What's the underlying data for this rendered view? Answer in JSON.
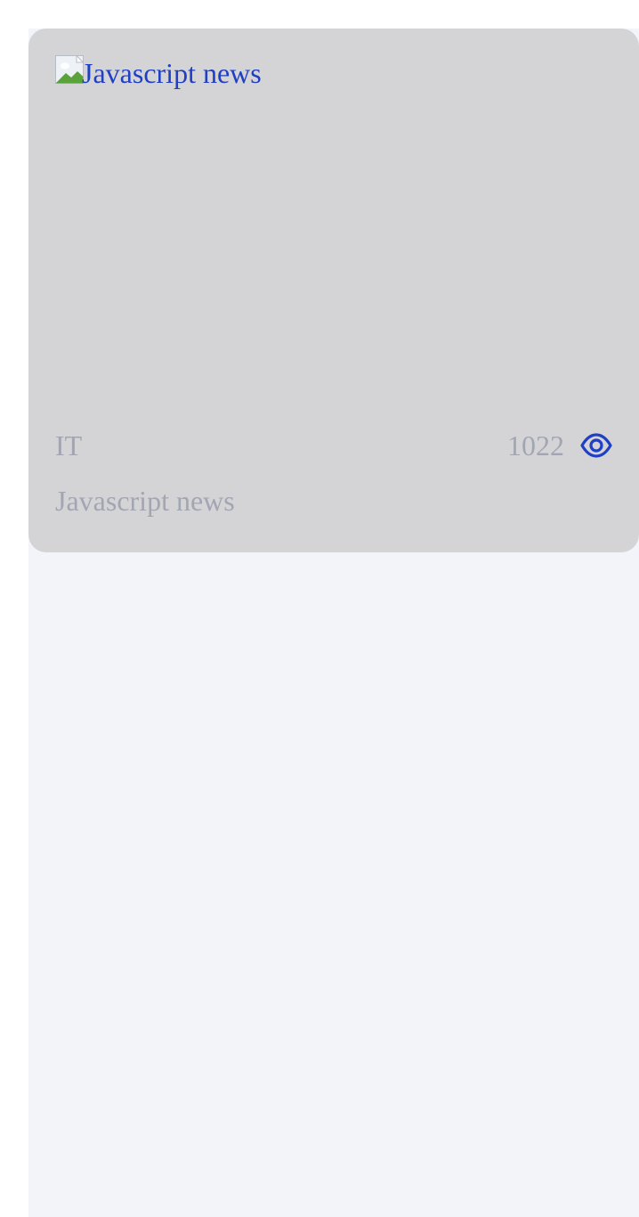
{
  "card": {
    "image_alt": "Javascript news",
    "category": "IT",
    "views": "1022",
    "title": "Javascript news",
    "view_icon": "eye-icon"
  },
  "colors": {
    "card_background": "#d4d4d7",
    "page_background": "#f3f4f9",
    "accent": "#1f3fc4",
    "muted_text": "#a2a6b3"
  }
}
